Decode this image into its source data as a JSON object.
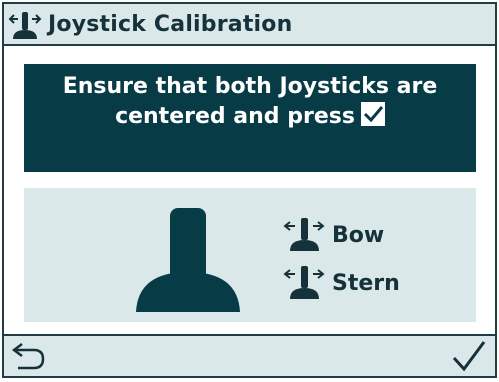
{
  "header": {
    "title": "Joystick Calibration",
    "icon": "joystick-arrows-icon"
  },
  "instruction": {
    "line1": "Ensure that both Joysticks are",
    "line2": "centered and press",
    "check_icon": "checkmark-icon"
  },
  "illustration": {
    "icon": "joystick-illustration"
  },
  "joysticks": [
    {
      "label": "Bow",
      "icon": "joystick-arrows-icon"
    },
    {
      "label": "Stern",
      "icon": "joystick-arrows-icon"
    }
  ],
  "footer": {
    "back_icon": "back-arrow-icon",
    "confirm_icon": "checkmark-icon"
  },
  "colors": {
    "dark_teal": "#073b45",
    "light_panel": "#dbe8ea",
    "text": "#15323a",
    "white": "#ffffff"
  }
}
